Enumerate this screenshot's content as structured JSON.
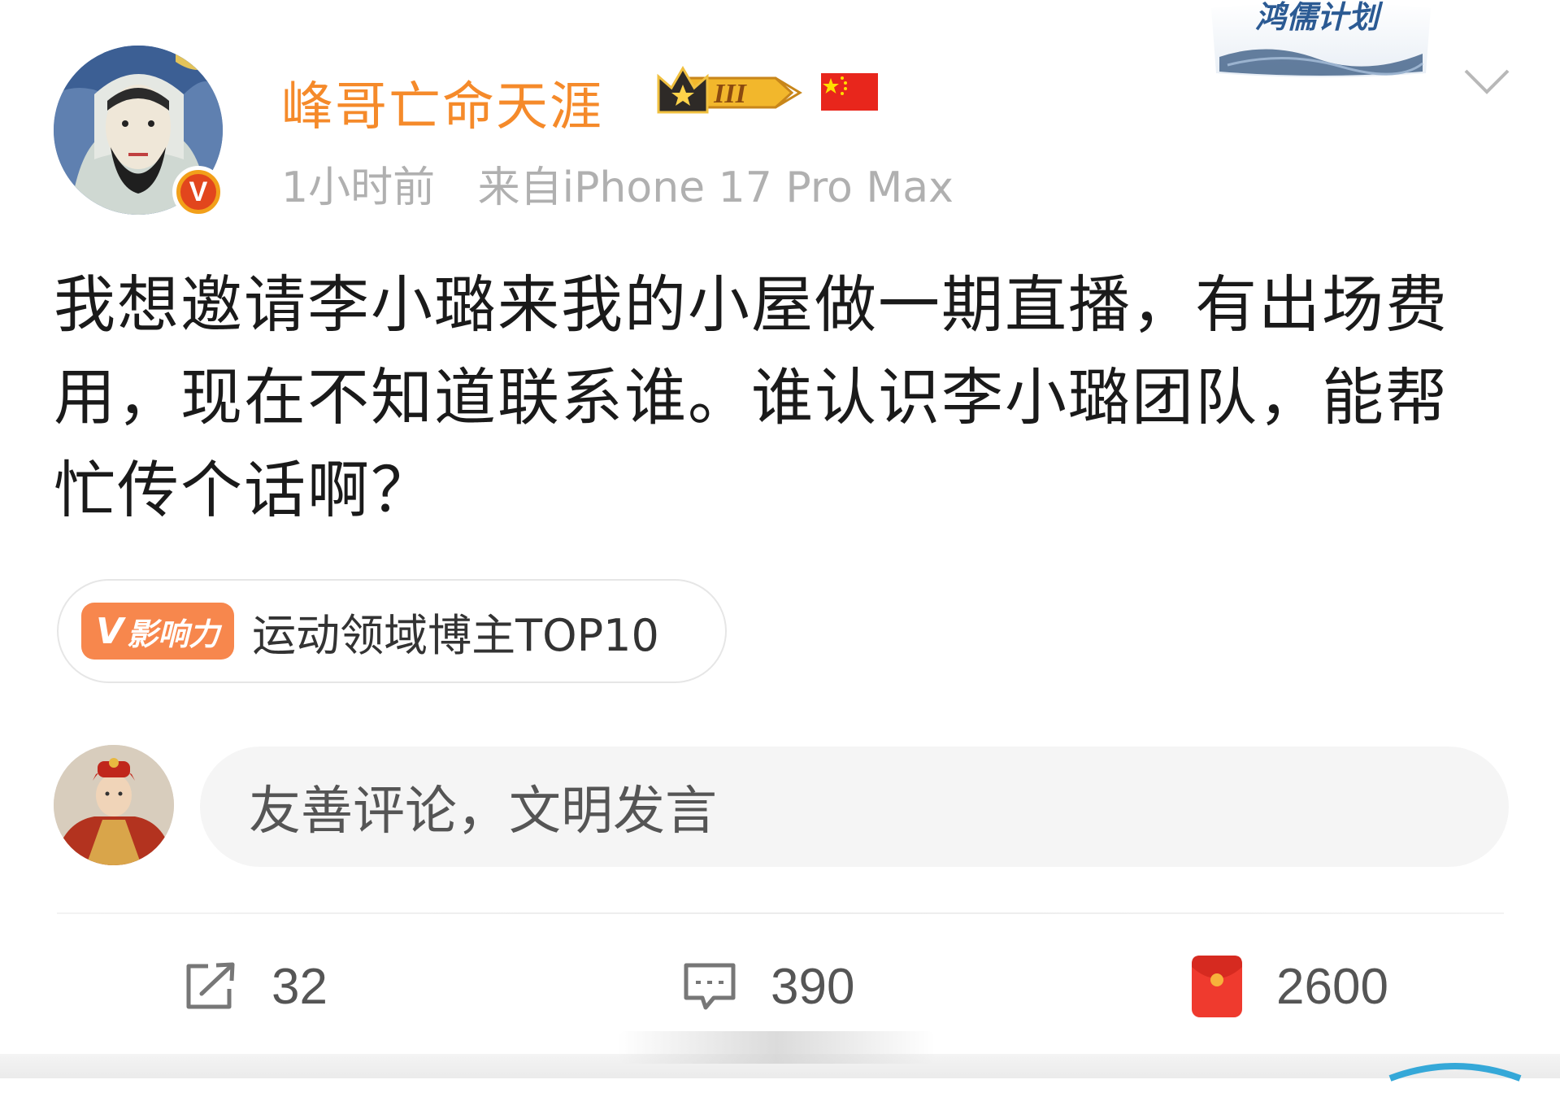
{
  "header": {
    "username": "峰哥亡命天涯",
    "level_badge": "III",
    "time": "1小时前",
    "source": "来自iPhone 17 Pro Max",
    "campaign_banner": "鸿儒计划"
  },
  "post": {
    "body": "我想邀请李小璐来我的小屋做一期直播，有出场费用，现在不知道联系谁。谁认识李小璐团队，能帮忙传个话啊？"
  },
  "influence": {
    "badge_mark": "V",
    "badge_label": "影响力",
    "text": "运动领域博主TOP10"
  },
  "comment": {
    "placeholder": "友善评论，文明发言"
  },
  "actions": {
    "share_count": "32",
    "comment_count": "390",
    "reward_count": "2600"
  },
  "colors": {
    "username": "#f58a2a",
    "influence_badge": "#f7874d",
    "meta_text": "#b0b0b0",
    "reward_red": "#ef3a2e"
  },
  "icons": {
    "share": "share-icon",
    "comment": "comment-icon",
    "reward": "red-envelope-icon",
    "more": "chevron-down-icon",
    "verified": "verified-v-icon",
    "flag": "china-flag-icon"
  }
}
